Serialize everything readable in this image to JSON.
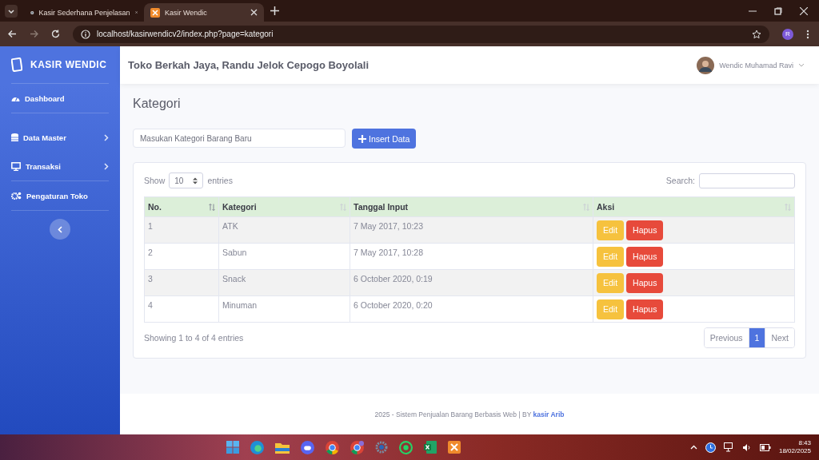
{
  "browser": {
    "tabs": [
      {
        "title": "Kasir Sederhana Penjelasan",
        "selected": false
      },
      {
        "title": "Kasir Wendic",
        "selected": true
      }
    ],
    "url": "localhost/kasirwendicv2/index.php?page=kategori",
    "profile_initial": "R"
  },
  "sidebar": {
    "brand": "KASIR WENDIC",
    "items": [
      {
        "label": "Dashboard",
        "kind": "dashboard",
        "expandable": false
      },
      {
        "label": "Data Master",
        "kind": "database",
        "expandable": true
      },
      {
        "label": "Transaksi",
        "kind": "monitor",
        "expandable": true
      },
      {
        "label": "Pengaturan Toko",
        "kind": "settings",
        "expandable": false
      }
    ]
  },
  "topbar": {
    "store_name": "Toko Berkah Jaya, Randu Jelok Cepogo Boyolali",
    "user_name": "Wendic Muhamad Ravi"
  },
  "page_title": "Kategori",
  "form": {
    "placeholder": "Masukan Kategori Barang Baru",
    "button": "Insert Data"
  },
  "table": {
    "length_prefix": "Show",
    "length_value": "10",
    "length_suffix": "entries",
    "search_label": "Search:",
    "columns": [
      {
        "label": "No.",
        "sorted": true
      },
      {
        "label": "Kategori",
        "sorted": false
      },
      {
        "label": "Tanggal Input",
        "sorted": false
      },
      {
        "label": "Aksi",
        "sorted": false
      }
    ],
    "rows": [
      {
        "no": "1",
        "kategori": "ATK",
        "tanggal": "7 May 2017, 10:23",
        "actions": [
          "Edit",
          "Hapus"
        ]
      },
      {
        "no": "2",
        "kategori": "Sabun",
        "tanggal": "7 May 2017, 10:28",
        "actions": [
          "Edit",
          "Hapus"
        ]
      },
      {
        "no": "3",
        "kategori": "Snack",
        "tanggal": "6 October 2020, 0:19",
        "actions": [
          "Edit",
          "Hapus"
        ]
      },
      {
        "no": "4",
        "kategori": "Minuman",
        "tanggal": "6 October 2020, 0:20",
        "actions": [
          "Edit",
          "Hapus"
        ]
      }
    ],
    "info": "Showing 1 to 4 of 4 entries",
    "pagination": [
      {
        "label": "Previous",
        "selected": false
      },
      {
        "label": "1",
        "selected": true
      },
      {
        "label": "Next",
        "selected": false
      }
    ]
  },
  "footer": {
    "text": "2025 - Sistem Penjualan Barang Berbasis Web | BY",
    "link": "kasir Arib"
  },
  "taskbar": {
    "time": "8:43",
    "date": "18/02/2025"
  }
}
